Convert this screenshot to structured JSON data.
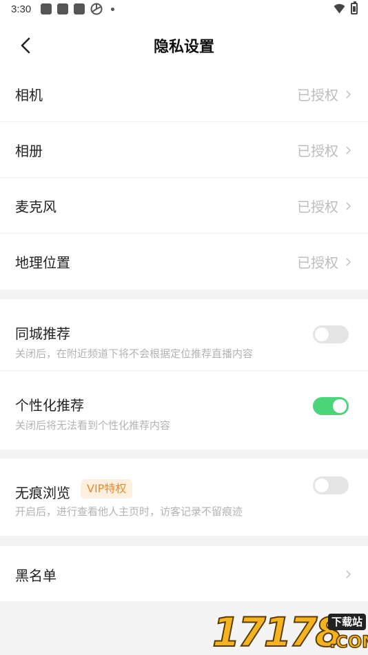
{
  "status_bar": {
    "time": "3:30"
  },
  "header": {
    "title": "隐私设置"
  },
  "permissions": [
    {
      "label": "相机",
      "value": "已授权"
    },
    {
      "label": "相册",
      "value": "已授权"
    },
    {
      "label": "麦克风",
      "value": "已授权"
    },
    {
      "label": "地理位置",
      "value": "已授权"
    }
  ],
  "recommend": {
    "local": {
      "label": "同城推荐",
      "desc": "关闭后，在附近频道下将不会根据定位推荐直播内容",
      "enabled": false
    },
    "personal": {
      "label": "个性化推荐",
      "desc": "关闭后将无法看到个性化推荐内容",
      "enabled": true
    }
  },
  "incognito": {
    "label": "无痕浏览",
    "badge": "VIP特权",
    "desc": "开启后，进行查看他人主页时，访客记录不留痕迹",
    "enabled": false
  },
  "blacklist": {
    "label": "黑名单"
  },
  "watermark": {
    "digits": "17178",
    "tag": "下载站",
    "suffix": ".COM"
  },
  "colors": {
    "toggle_on": "#4cd47a",
    "toggle_off": "#e4e4e4",
    "badge_text": "#e78a2c",
    "badge_bg": "#fdf0df"
  }
}
